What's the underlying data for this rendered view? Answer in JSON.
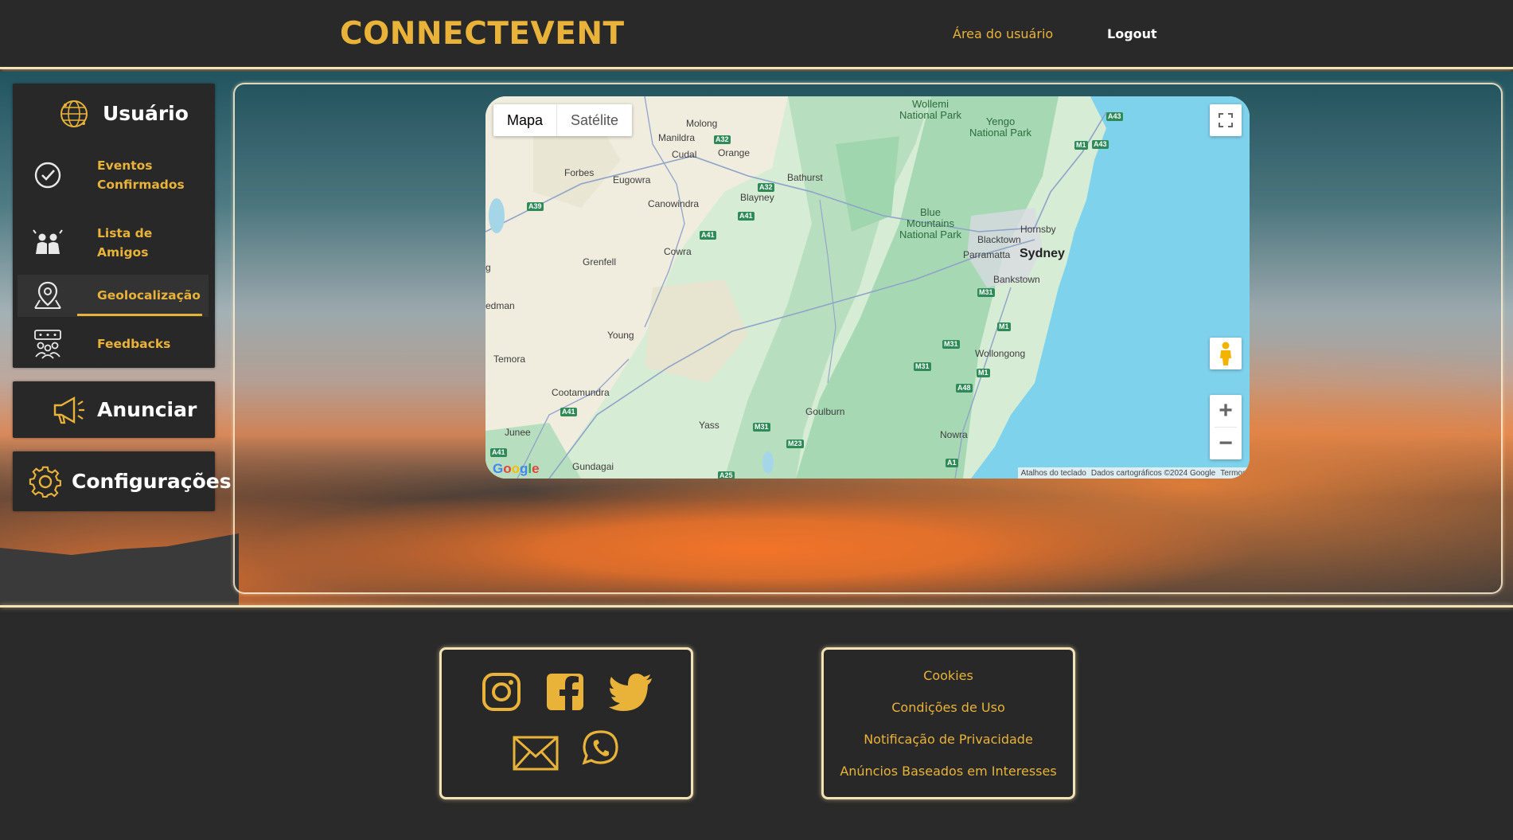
{
  "header": {
    "logo": "CONNECTEVENT",
    "nav_user_area": "Área do usuário",
    "nav_logout": "Logout"
  },
  "sidebar": {
    "title": "Usuário",
    "items": [
      {
        "label_line1": "Eventos",
        "label_line2": "Confirmados",
        "icon": "check-circle-icon"
      },
      {
        "label_line1": "Lista de",
        "label_line2": "Amigos",
        "icon": "friends-icon"
      },
      {
        "label": "Geolocalização",
        "icon": "map-pin-icon",
        "active": true
      },
      {
        "label": "Feedbacks",
        "icon": "feedback-people-icon"
      }
    ],
    "announce_label": "Anunciar",
    "config_label": "Configurações"
  },
  "map": {
    "toggle": {
      "map": "Mapa",
      "satellite": "Satélite"
    },
    "places": {
      "sydney": "Sydney",
      "wollemi": "Wollemi\nNational Park",
      "yengo": "Yengo\nNational Park",
      "blue_mountains": "Blue\nMountains\nNational Park",
      "molong": "Molong",
      "manildra": "Manildra",
      "cudal": "Cudal",
      "orange": "Orange",
      "forbes": "Forbes",
      "eugowra": "Eugowra",
      "bathurst": "Bathurst",
      "blayney": "Blayney",
      "canowindra": "Canowindra",
      "cowra": "Cowra",
      "grenfell": "Grenfell",
      "hornsby": "Hornsby",
      "blacktown": "Blacktown",
      "parramatta": "Parramatta",
      "bankstown": "Bankstown",
      "wollongong": "Wollongong",
      "young": "Young",
      "temora": "Temora",
      "cootamundra": "Cootamundra",
      "yass": "Yass",
      "goulburn": "Goulburn",
      "junee": "Junee",
      "gundagai": "Gundagai",
      "nowra": "Nowra",
      "edman": "edman",
      "g": "g"
    },
    "shields": [
      "A32",
      "A39",
      "A32",
      "A41",
      "A41",
      "A43",
      "M1",
      "A43",
      "M31",
      "M1",
      "M31",
      "M31",
      "M1",
      "A48",
      "A41",
      "M31",
      "M23",
      "A41",
      "A1",
      "A25"
    ],
    "footer": {
      "shortcuts": "Atalhos do teclado",
      "data": "Dados cartográficos ©2024 Google",
      "terms": "Termos"
    },
    "google_logo": "Google"
  },
  "footer": {
    "social_icons": [
      "instagram-icon",
      "facebook-icon",
      "twitter-icon",
      "email-icon",
      "whatsapp-icon"
    ],
    "links": [
      "Cookies",
      "Condições de Uso",
      "Notificação de Privacidade",
      "Anúncios Baseados em Interesses"
    ]
  },
  "colors": {
    "accent": "#e9b33a",
    "dark": "#282828",
    "border_glow": "#f3e2b6"
  }
}
